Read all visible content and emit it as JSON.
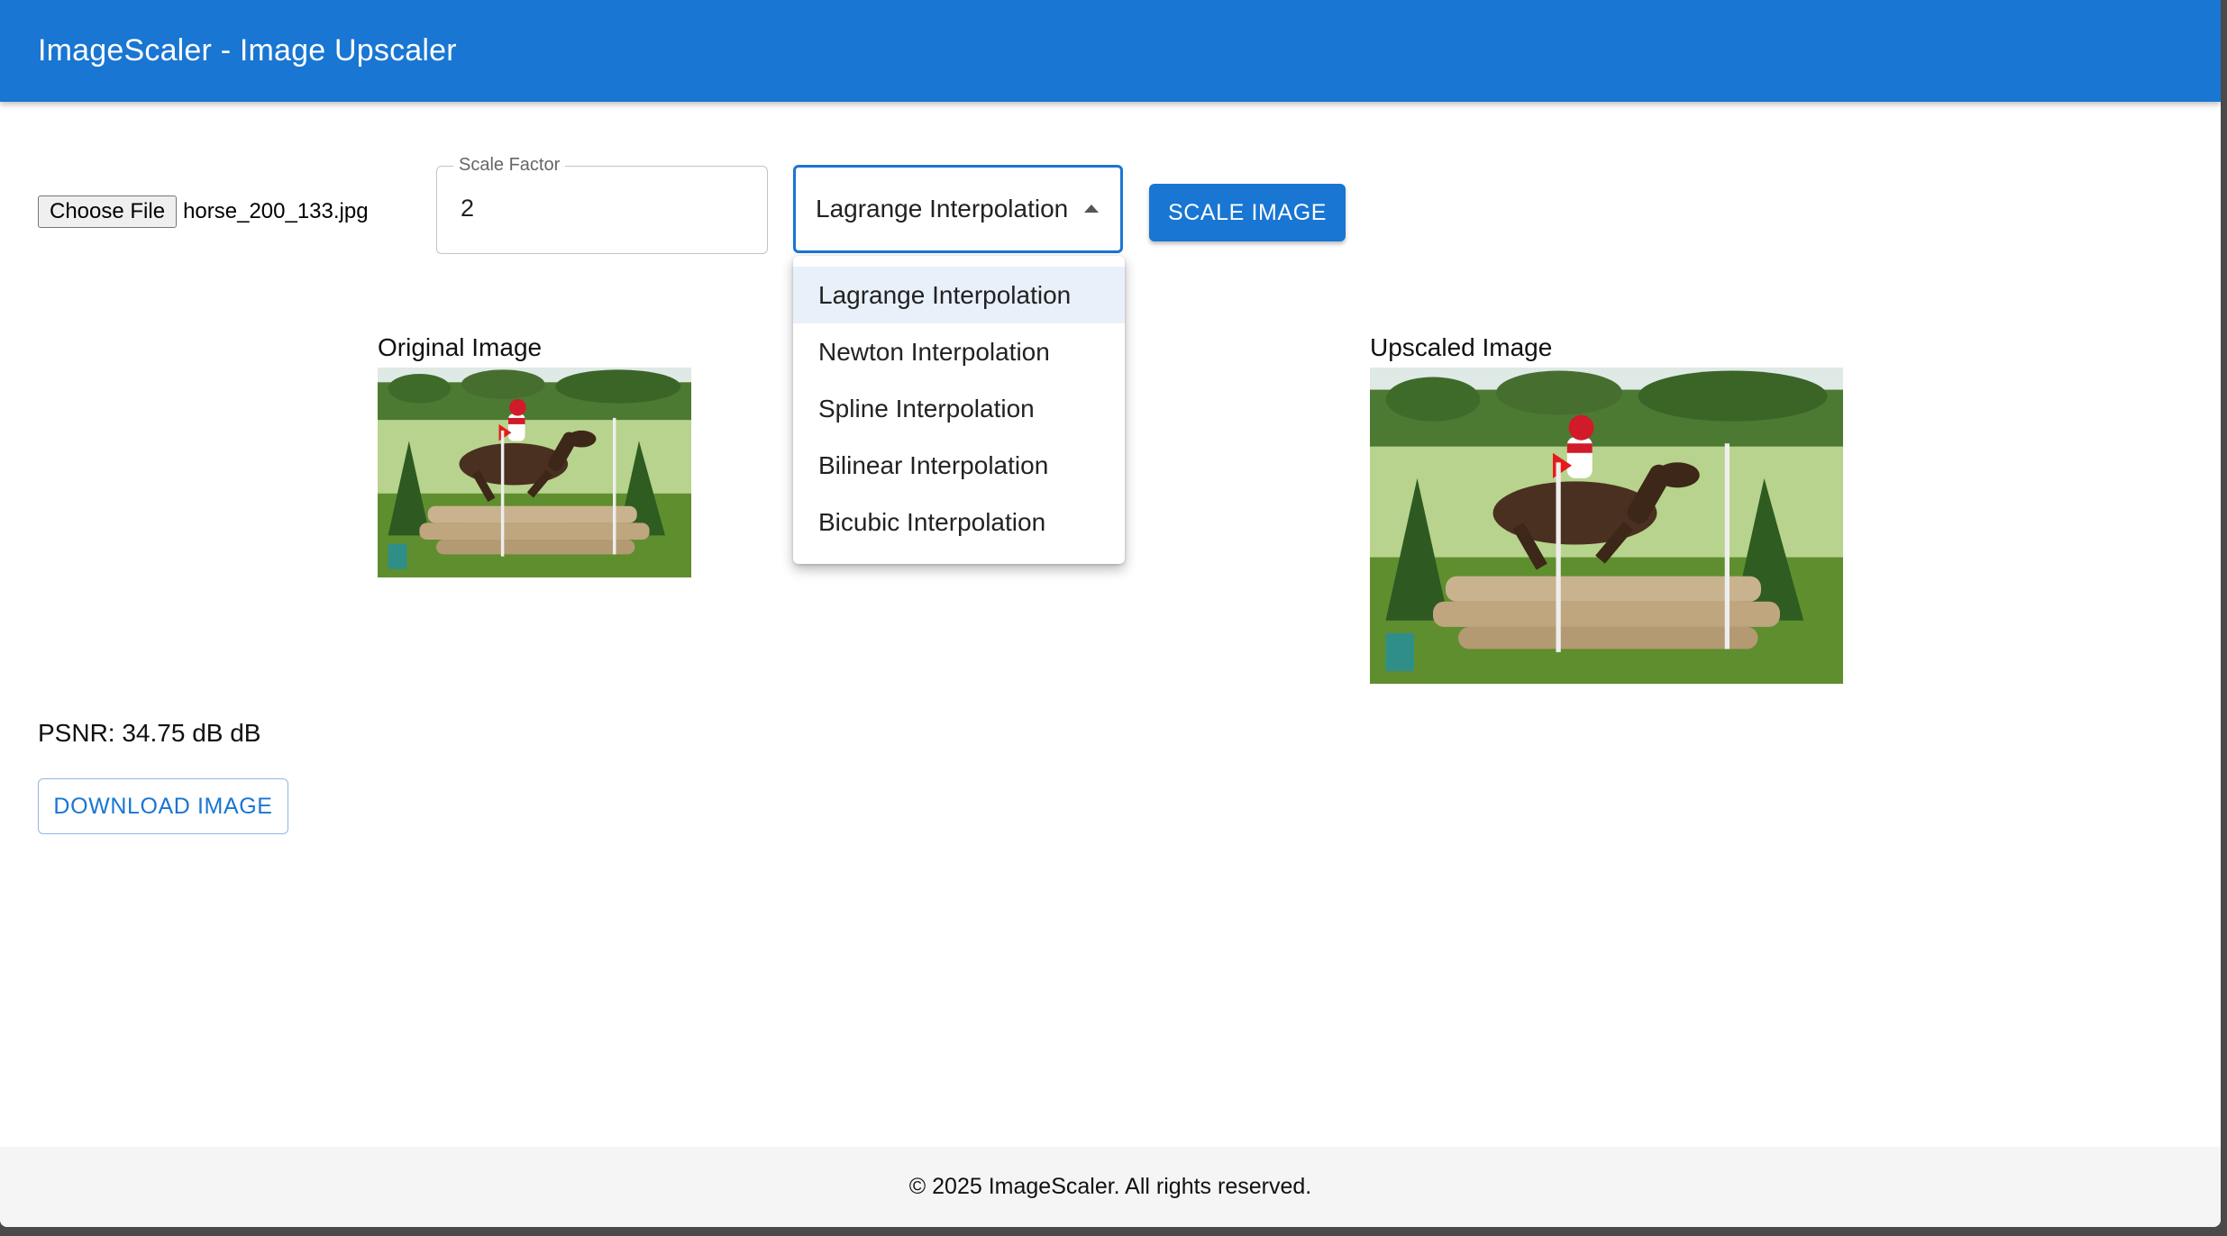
{
  "app": {
    "title": "ImageScaler - Image Upscaler"
  },
  "controls": {
    "file_button_label": "Choose File",
    "file_name": "horse_200_133.jpg",
    "scale_factor_label": "Scale Factor",
    "scale_factor_value": "2",
    "method_selected": "Lagrange Interpolation",
    "scale_button_label": "SCALE IMAGE"
  },
  "dropdown": {
    "options": [
      "Lagrange Interpolation",
      "Newton Interpolation",
      "Spline Interpolation",
      "Bilinear Interpolation",
      "Bicubic Interpolation"
    ],
    "selected_index": 0
  },
  "images": {
    "original_caption": "Original Image",
    "upscaled_caption": "Upscaled Image"
  },
  "results": {
    "psnr_text": "PSNR: 34.75 dB dB",
    "download_label": "DOWNLOAD IMAGE"
  },
  "footer": {
    "text": "© 2025 ImageScaler. All rights reserved."
  },
  "colors": {
    "primary": "#1976d2",
    "footer_bg": "#f5f5f5",
    "selected_option_bg": "#e8f0fa"
  }
}
